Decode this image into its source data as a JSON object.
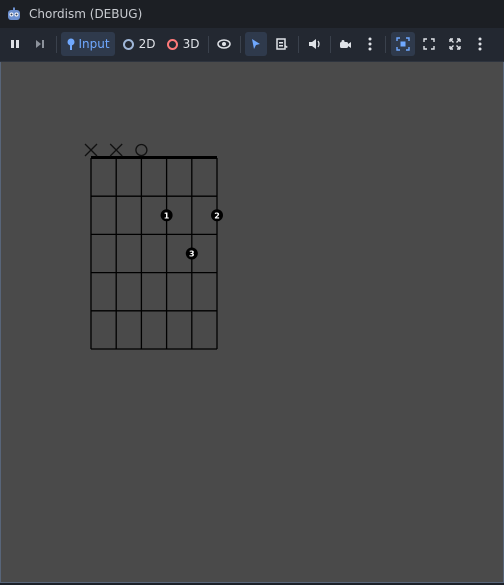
{
  "window": {
    "title": "Chordism (DEBUG)"
  },
  "toolbar": {
    "input_label": "Input",
    "mode_2d_label": "2D",
    "mode_3d_label": "3D",
    "ring_2d_color": "#9fb7d8",
    "ring_3d_color": "#ff7a7a",
    "accent": "#6fa8ff"
  },
  "chord": {
    "strings": 6,
    "frets": 5,
    "string_markers": [
      "X",
      "X",
      "O",
      "",
      "",
      ""
    ],
    "fingers": [
      {
        "string": 4,
        "fret": 2,
        "finger": "1"
      },
      {
        "string": 6,
        "fret": 2,
        "finger": "2"
      },
      {
        "string": 5,
        "fret": 3,
        "finger": "3"
      }
    ]
  }
}
